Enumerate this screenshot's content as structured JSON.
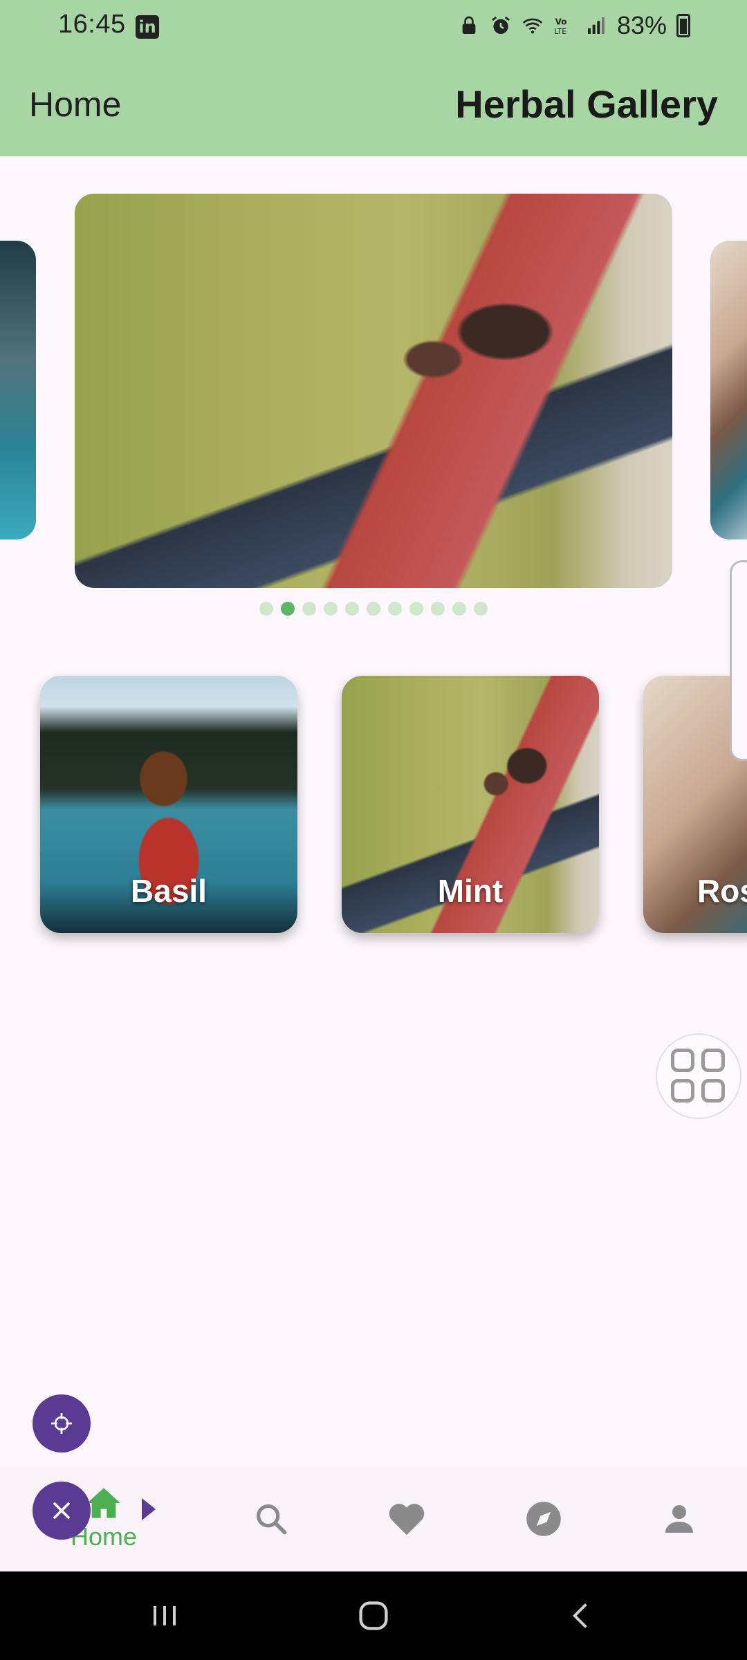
{
  "status_bar": {
    "time": "16:45",
    "linkedin_badge": "in",
    "battery_percent": "83%"
  },
  "app_bar": {
    "left_title": "Home",
    "right_title": "Herbal Gallery"
  },
  "carousel": {
    "slide_count": 11,
    "active_index": 1,
    "slides": [
      {
        "image": "lake-scene"
      },
      {
        "image": "man-with-dog-in-field"
      },
      {
        "image": "woman-in-car"
      }
    ]
  },
  "cards": [
    {
      "label": "Basil",
      "image": "girl-in-canoe"
    },
    {
      "label": "Mint",
      "image": "man-with-dog-in-field"
    },
    {
      "label": "Ros",
      "image": "woman-in-car"
    }
  ],
  "bottom_nav": {
    "items": [
      {
        "label": "Home",
        "icon": "home-icon",
        "active": true
      },
      {
        "icon": "search-icon"
      },
      {
        "icon": "heart-icon"
      },
      {
        "icon": "compass-icon"
      },
      {
        "icon": "person-icon"
      }
    ]
  },
  "colors": {
    "app_bar": "#a8d5a4",
    "accent_green": "#4caf50",
    "fab_purple": "#5b3a93",
    "background": "#fdf6fc"
  }
}
